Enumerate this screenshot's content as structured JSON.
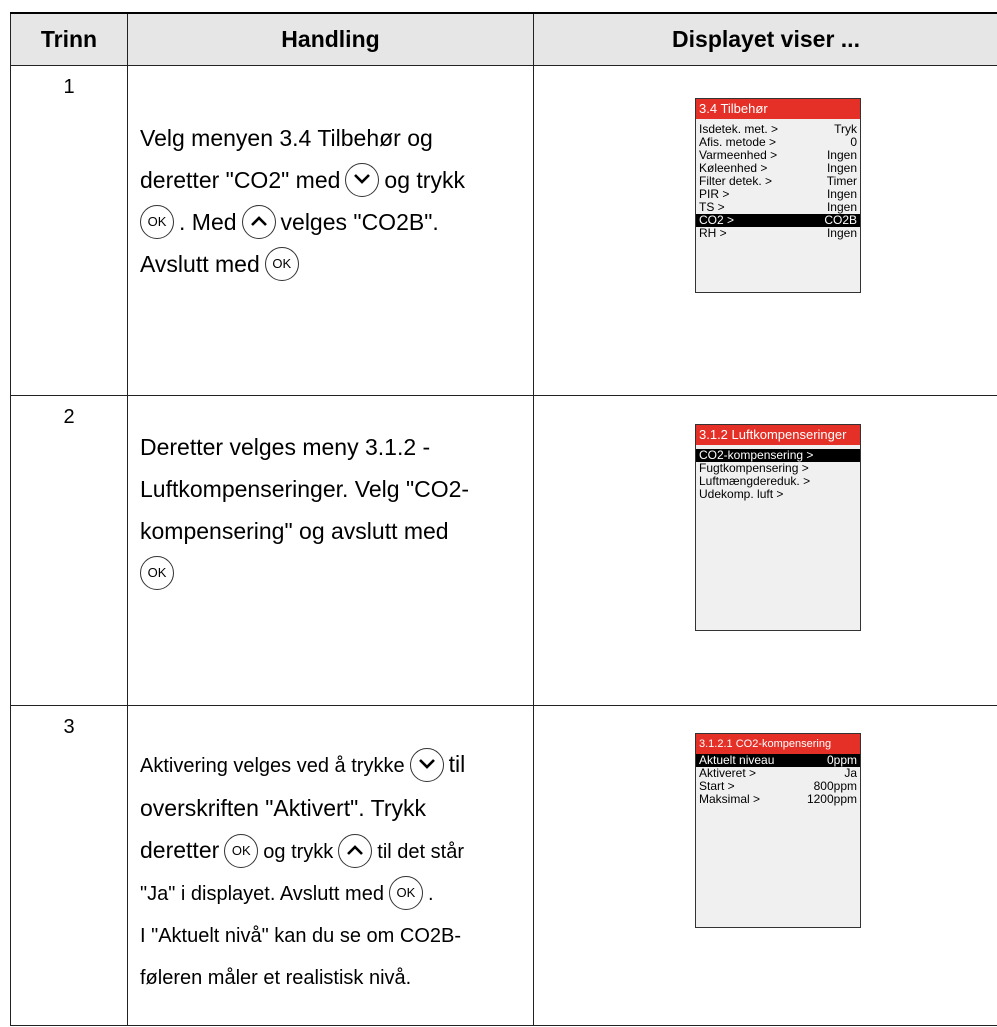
{
  "header": {
    "col1": "Trinn",
    "col2": "Handling",
    "col3": "Displayet viser ..."
  },
  "buttons": {
    "ok_label": "OK",
    "down_icon": "chevron-down-icon",
    "up_icon": "chevron-up-icon"
  },
  "colors": {
    "lcd_title_bg": "#e53027",
    "lcd_bg": "#f0f0f0",
    "header_bg": "#e6e6e6"
  },
  "steps": [
    {
      "num": "1",
      "text": {
        "p1": "Velg menyen 3.4 Tilbehør og",
        "p2": "deretter \"CO2\" med",
        "p3": "og trykk",
        "p4": ". Med",
        "p5": "velges \"CO2B\".",
        "p6": "Avslutt med"
      },
      "display": {
        "title": "3.4 Tilbehør",
        "rows": [
          {
            "label": "Isdetek. met. >",
            "value": "Tryk"
          },
          {
            "label": "Afis. metode >",
            "value": "0"
          },
          {
            "label": "Varmeenhed >",
            "value": "Ingen"
          },
          {
            "label": "Køleenhed >",
            "value": "Ingen"
          },
          {
            "label": "Filter detek. >",
            "value": "Timer"
          },
          {
            "label": "PIR >",
            "value": "Ingen"
          },
          {
            "label": "TS >",
            "value": "Ingen"
          },
          {
            "label": "CO2 >",
            "value": "CO2B",
            "selected": true
          },
          {
            "label": "RH >",
            "value": "Ingen"
          }
        ]
      }
    },
    {
      "num": "2",
      "text": {
        "p1": "Deretter velges meny 3.1.2 -",
        "p2": "Luftkompenseringer. Velg \"CO2-",
        "p3": "kompensering\" og avslutt med"
      },
      "display": {
        "title": "3.1.2 Luftkompenseringer",
        "rows": [
          {
            "label": "CO2-kompensering >",
            "value": "",
            "selected": true
          },
          {
            "label": "Fugtkompensering >",
            "value": ""
          },
          {
            "label": "Luftmængdereduk. >",
            "value": ""
          },
          {
            "label": "Udekomp. luft >",
            "value": ""
          }
        ]
      }
    },
    {
      "num": "3",
      "text": {
        "p1": "Aktivering velges ved å trykke",
        "p2": "til",
        "p3": "overskriften \"Aktivert\". Trykk",
        "p4": "deretter",
        "p5": "og trykk",
        "p6": "til det står",
        "p7": "\"Ja\" i displayet. Avslutt med",
        "p8": ".",
        "p9": "I \"Aktuelt nivå\" kan du se om CO2B-",
        "p10": "føleren måler et realistisk nivå."
      },
      "display": {
        "title": "3.1.2.1 CO2-kompensering",
        "rows": [
          {
            "label": "Aktuelt niveau",
            "value": "0ppm",
            "selected": true
          },
          {
            "label": "Aktiveret >",
            "value": "Ja"
          },
          {
            "label": "Start >",
            "value": "800ppm"
          },
          {
            "label": "Maksimal >",
            "value": "1200ppm"
          }
        ]
      }
    }
  ]
}
